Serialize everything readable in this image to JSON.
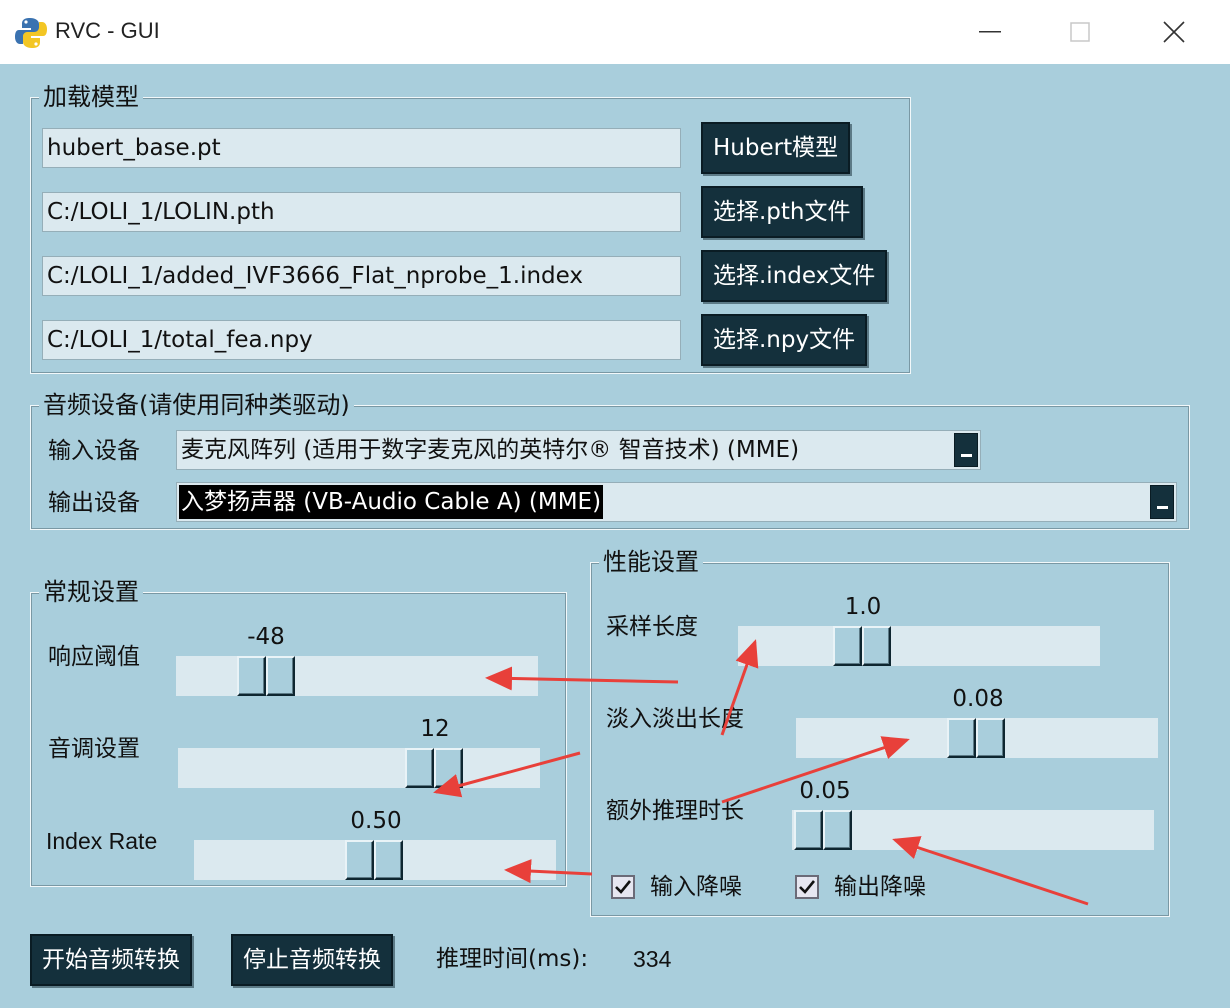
{
  "window": {
    "title": "RVC - GUI"
  },
  "load_model": {
    "legend": "加载模型",
    "hubert_path": "hubert_base.pt",
    "pth_path": "C:/LOLI_1/LOLIN.pth",
    "index_path": "C:/LOLI_1/added_IVF3666_Flat_nprobe_1.index",
    "npy_path": "C:/LOLI_1/total_fea.npy",
    "hubert_btn": "Hubert模型",
    "pth_btn": "选择.pth文件",
    "index_btn": "选择.index文件",
    "npy_btn": "选择.npy文件"
  },
  "audio_device": {
    "legend": "音频设备(请使用同种类驱动)",
    "input_label": "输入设备",
    "input_value": "麦克风阵列 (适用于数字麦克风的英特尔® 智音技术) (MME)",
    "output_label": "输出设备",
    "output_value": "入梦扬声器 (VB-Audio Cable A) (MME)"
  },
  "general": {
    "legend": "常规设置",
    "threshold_label": "响应阈值",
    "threshold_value": "-48",
    "pitch_label": "音调设置",
    "pitch_value": "12",
    "index_rate_label": "Index Rate",
    "index_rate_value": "0.50"
  },
  "performance": {
    "legend": "性能设置",
    "sample_len_label": "采样长度",
    "sample_len_value": "1.0",
    "fade_len_label": "淡入淡出长度",
    "fade_len_value": "0.08",
    "extra_time_label": "额外推理时长",
    "extra_time_value": "0.05",
    "input_denoise_label": "输入降噪",
    "output_denoise_label": "输出降噪"
  },
  "bottom": {
    "start_btn": "开始音频转换",
    "stop_btn": "停止音频转换",
    "infer_time_label": "推理时间(ms):",
    "infer_time_value": "334"
  },
  "colors": {
    "window_bg": "#a9cedc",
    "button_bg": "#14303c",
    "field_bg": "#dbe9ef",
    "annotation_arrow": "#e8403a"
  }
}
